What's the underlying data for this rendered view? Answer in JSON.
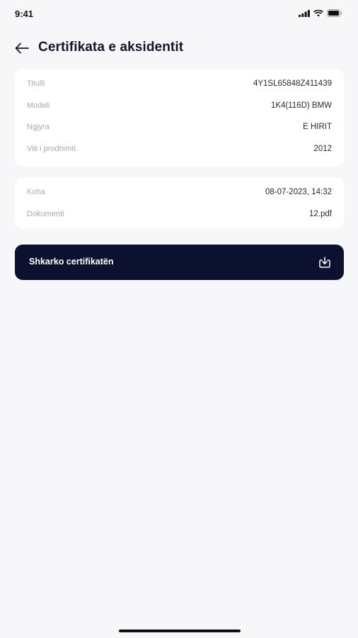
{
  "status_bar": {
    "time": "9:41"
  },
  "header": {
    "title": "Certifikata e aksidentit",
    "back_icon": "arrow-left-icon"
  },
  "vehicle_card": {
    "rows": [
      {
        "label": "Titulli",
        "value": "4Y1SL65848Z411439"
      },
      {
        "label": "Modeli",
        "value": "1K4(116D) BMW"
      },
      {
        "label": "Ngjyra",
        "value": "E HIRIT"
      },
      {
        "label": "Viti i prodhimit",
        "value": "2012"
      }
    ]
  },
  "document_card": {
    "rows": [
      {
        "label": "Koha",
        "value": "08-07-2023, 14:32"
      },
      {
        "label": "Dokumenti",
        "value": "12.pdf"
      }
    ]
  },
  "download_button": {
    "label": "Shkarko certifikatën",
    "icon": "download-icon"
  },
  "colors": {
    "background": "#f7f7f9",
    "card": "#ffffff",
    "primary": "#0c1130",
    "label_text": "#a6a9b1",
    "value_text": "#1f2937"
  }
}
